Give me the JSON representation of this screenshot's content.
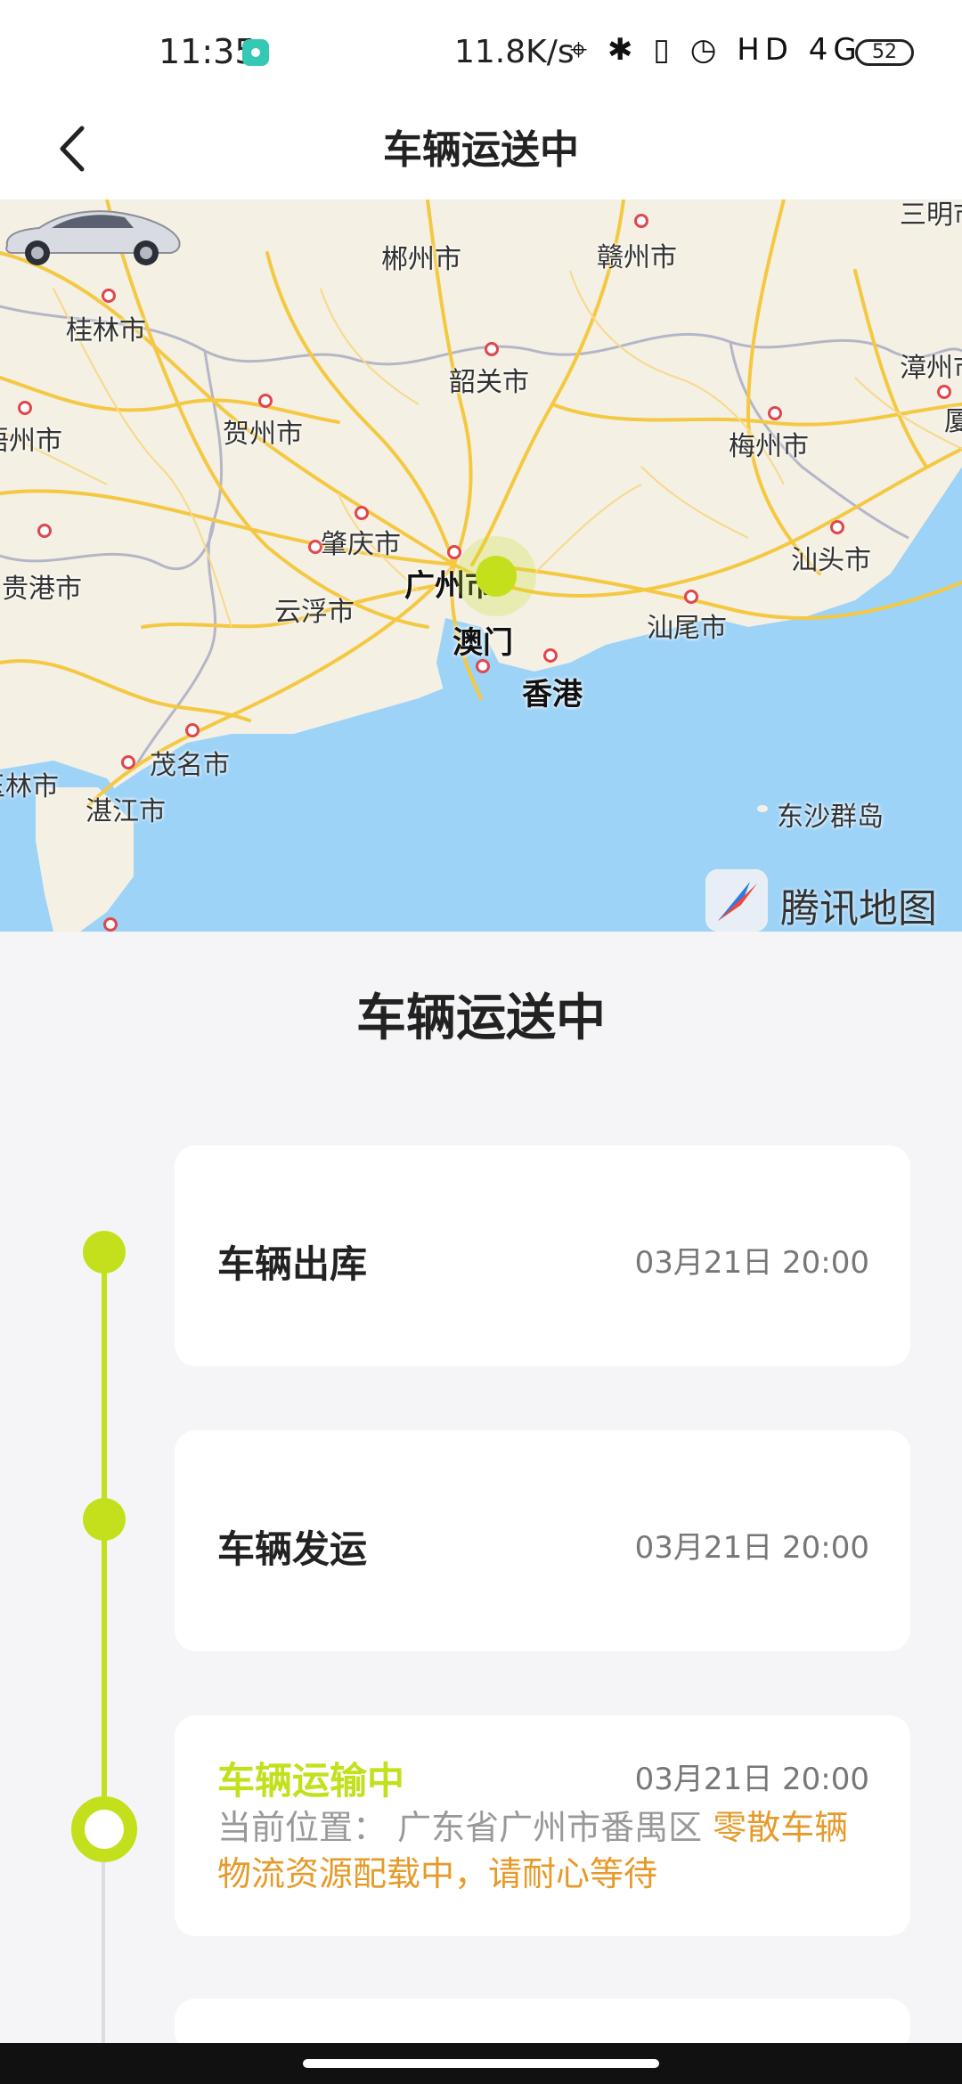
{
  "status_bar": {
    "time": "11:35",
    "network_speed": "11.8K/s",
    "icons_text": "⌖ ✱ ▯ ◷ HD 4G",
    "battery": "52"
  },
  "nav": {
    "title": "车辆运送中",
    "back_icon": "chevron-left-icon"
  },
  "map": {
    "labels": {
      "chenzhou": "郴州市",
      "ganzhou": "赣州市",
      "guilin": "桂林市",
      "shaoguan": "韶关市",
      "zhangzhou": "漳州市",
      "hezhou": "贺州市",
      "wuzhou": "梧州市",
      "meizhou": "梅州市",
      "zhaoqing": "肇庆市",
      "shantou": "汕头市",
      "guigang": "贵港市",
      "guangzhou": "广州市",
      "yunfu": "云浮市",
      "macau": "澳门",
      "shanwei": "汕尾市",
      "hongkong": "香港",
      "maoming": "茂名市",
      "zhanjiang": "湛江市",
      "dongsha": "东沙群岛",
      "yulin": "玉林市",
      "xiamen": "厦门",
      "sanming": "三明市"
    },
    "brand": "腾讯地图",
    "colors": {
      "land": "#f4f0e4",
      "sea": "#9dd3f7",
      "road": "#f5c842",
      "border": "#b5b5c8",
      "accent": "#c4e01c"
    }
  },
  "section_title": "车辆运送中",
  "timeline": [
    {
      "title": "车辆出库",
      "time": "03月21日 20:00"
    },
    {
      "title": "车辆发运",
      "time": "03月21日 20:00"
    },
    {
      "title": "车辆运输中",
      "time": "03月21日 20:00",
      "location_label": "当前位置：",
      "location": "广东省广州市番禺区",
      "status": "零散车辆物流资源配载中，请耐心等待"
    }
  ]
}
